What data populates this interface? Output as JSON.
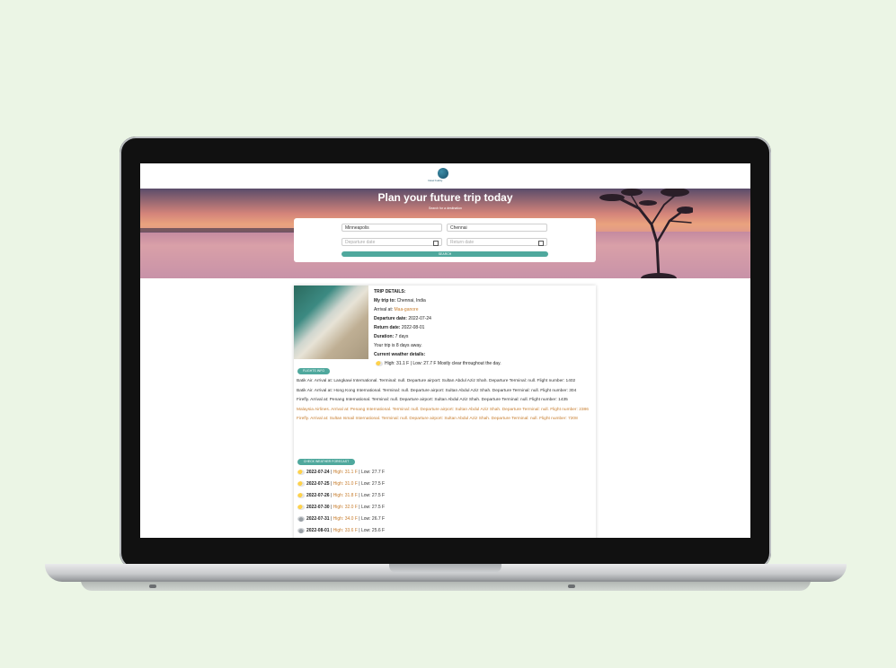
{
  "page": {
    "logo_text": "travel buddy",
    "hero_title": "Plan your future trip today",
    "hero_subtitle": "Search for a destination"
  },
  "search": {
    "from_value": "Minneapolis",
    "to_value": "Chennai",
    "depart_placeholder": "Departure date",
    "return_placeholder": "Return date",
    "button_label": "SEARCH"
  },
  "trip": {
    "heading": "TRIP DETAILS:",
    "lines": {
      "my_trip_label": "My trip to:",
      "my_trip_value": "Chennai, India",
      "arrival_label": "Arrival at:",
      "arrival_value": "Maa-ganore",
      "departure_label": "Departure date:",
      "departure_value": "2022-07-24",
      "return_label": "Return date:",
      "return_value": "2022-08-01",
      "duration_label": "Duration:",
      "duration_value": "7 days",
      "away_value": "Your trip is 8 days away.",
      "weather_label": "Current weather details:"
    },
    "current_weather": "High: 31.1 F | Low: 27.7 F Mostly clear throughout the day.",
    "flights_button": "FLIGHTS INFO",
    "flights": [
      {
        "airline": "Batik Air.",
        "text": "Arrival at: Langkawi International. Terminal: null. Departure airport: Sultan Abdul Aziz Shah. Departure Terminal: null. Flight number: 1402"
      },
      {
        "airline": "Batik Air.",
        "text": "Arrival at: Hong Kong International. Terminal: null. Departure airport: Sultan Abdul Aziz Shah. Departure Terminal: null. Flight number: 304"
      },
      {
        "airline": "Firefly.",
        "text": "Arrival at: Penang International. Terminal: null. Departure airport: Sultan Abdul Aziz Shah. Departure Terminal: null. Flight number: 1435"
      },
      {
        "airline": "Malaysia Airlines.",
        "text": "Arrival at: Penang International. Terminal: null. Departure airport: Sultan Abdul Aziz Shah. Departure Terminal: null. Flight number: 2386"
      },
      {
        "airline": "Firefly.",
        "text": "Arrival at: Sultan Ismail International. Terminal: null. Departure airport: Sultan Abdul Aziz Shah. Departure Terminal: null. Flight number: 7208"
      }
    ],
    "forecast_button": "CHECK WEATHER FORECAST",
    "forecast": [
      {
        "date": "2022-07-24",
        "high": "High: 31.1 F",
        "low": "Low: 27.7 F",
        "icon": "sun-cloud-icon"
      },
      {
        "date": "2022-07-25",
        "high": "High: 31.0 F",
        "low": "Low: 27.5 F",
        "icon": "sun-cloud-icon"
      },
      {
        "date": "2022-07-26",
        "high": "High: 31.8 F",
        "low": "Low: 27.5 F",
        "icon": "sun-cloud-icon"
      },
      {
        "date": "2022-07-30",
        "high": "High: 32.0 F",
        "low": "Low: 27.5 F",
        "icon": "sun-cloud-icon"
      },
      {
        "date": "2022-07-31",
        "high": "High: 34.0 F",
        "low": "Low: 26.7 F",
        "icon": "cloud-icon"
      },
      {
        "date": "2022-08-01",
        "high": "High: 33.6 F",
        "low": "Low: 25.6 F",
        "icon": "cloud-icon"
      }
    ]
  }
}
